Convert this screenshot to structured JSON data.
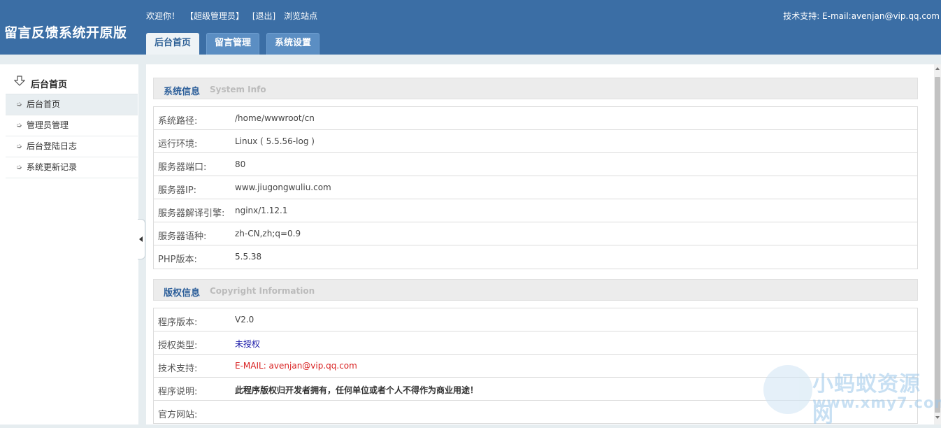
{
  "header": {
    "logo": "留言反馈系统开原版",
    "welcome": "欢迎你！",
    "role": "【超级管理员】",
    "logout": "[退出]",
    "browse": "浏览站点",
    "support": "技术支持: E-mail:avenjan@vip.qq.com"
  },
  "tabs": [
    {
      "label": "后台首页"
    },
    {
      "label": "留言管理"
    },
    {
      "label": "系统设置"
    }
  ],
  "sidebar": {
    "title": "后台首页",
    "items": [
      {
        "label": "后台首页"
      },
      {
        "label": "管理员管理"
      },
      {
        "label": "后台登陆日志"
      },
      {
        "label": "系统更新记录"
      }
    ]
  },
  "system_info": {
    "title_cn": "系统信息",
    "title_en": "System  Info",
    "rows": [
      {
        "key": "系统路径:",
        "value": "/home/wwwroot/cn"
      },
      {
        "key": "运行环境:",
        "value": "Linux ( 5.5.56-log )"
      },
      {
        "key": "服务器端口:",
        "value": "80"
      },
      {
        "key": "服务器IP:",
        "value": "www.jiugongwuliu.com"
      },
      {
        "key": "服务器解译引擎:",
        "value": "nginx/1.12.1"
      },
      {
        "key": "服务器语种:",
        "value": "zh-CN,zh;q=0.9"
      },
      {
        "key": "PHP版本:",
        "value": "5.5.38"
      }
    ]
  },
  "copyright": {
    "title_cn": "版权信息",
    "title_en": "Copyright Information",
    "rows": [
      {
        "key": "程序版本:",
        "value": "V2.0"
      },
      {
        "key": "授权类型:",
        "value": "未授权"
      },
      {
        "key": "技术支持:",
        "value": "E-MAIL: avenjan@vip.qq.com"
      },
      {
        "key": "程序说明:",
        "value": "此程序版权归开发者拥有，任何单位或者个人不得作为商业用途！"
      },
      {
        "key": "官方网站:",
        "value": ""
      }
    ]
  },
  "watermark": {
    "line1": "小蚂蚁资源网",
    "line2": "www.xmy7.com"
  },
  "colors": {
    "header_bg": "#3b6ea5",
    "link_blue": "#1a1aa8",
    "alert_red": "#d81f1f"
  }
}
